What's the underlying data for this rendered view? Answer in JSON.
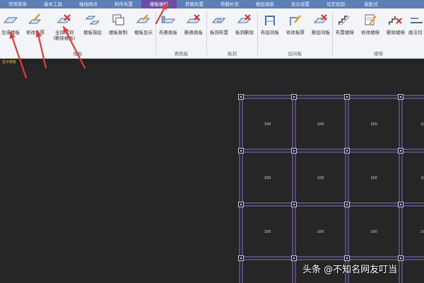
{
  "menu": {
    "tabs": [
      "常用菜单",
      "基本工具",
      "轴线网点",
      "构件布置",
      "楼板楼梯",
      "荷载布置",
      "荷载补充",
      "楼层组装",
      "显示设置",
      "设定加固",
      "装配式"
    ],
    "active_index": 4
  },
  "ribbon": {
    "buttons": [
      {
        "label": "生成楼板",
        "icon": "generate-slab-icon"
      },
      {
        "label": "修改板厚",
        "icon": "edit-thickness-icon"
      },
      {
        "label": "全房间洞",
        "sublabel": "(删除楼板)",
        "icon": "room-hole-icon"
      },
      {
        "label": "楼板错层",
        "icon": "slab-offset-icon"
      },
      {
        "label": "楼板复制",
        "icon": "slab-copy-icon"
      },
      {
        "label": "楼板显示",
        "icon": "slab-display-icon"
      },
      {
        "label": "布悬挑板",
        "icon": "cantilever-place-icon"
      },
      {
        "label": "删悬挑板",
        "icon": "cantilever-delete-icon"
      },
      {
        "label": "板洞布置",
        "icon": "slab-hole-place-icon"
      },
      {
        "label": "板洞删除",
        "icon": "slab-hole-delete-icon"
      },
      {
        "label": "布层间板",
        "icon": "interlayer-place-icon"
      },
      {
        "label": "修改板厚",
        "icon": "interlayer-thickness-icon"
      },
      {
        "label": "删层间板",
        "icon": "interlayer-delete-icon"
      },
      {
        "label": "布置楼梯",
        "icon": "stair-place-icon"
      },
      {
        "label": "修改楼梯",
        "icon": "stair-edit-icon"
      },
      {
        "label": "删除楼梯",
        "icon": "stair-delete-icon"
      },
      {
        "label": "画法切",
        "icon": "draw-method-icon"
      }
    ],
    "groups": [
      "楼板",
      "悬挑板",
      "板洞",
      "层间板",
      "楼梯"
    ]
  },
  "status_text": "显示楼板",
  "canvas": {
    "cell_label": "100",
    "grid_color": "#7a5fb0",
    "node_color": "#c4c9e8",
    "background": "#262626"
  },
  "watermark": "头条 @不知名网友叮当",
  "annotation_color": "#e53935"
}
